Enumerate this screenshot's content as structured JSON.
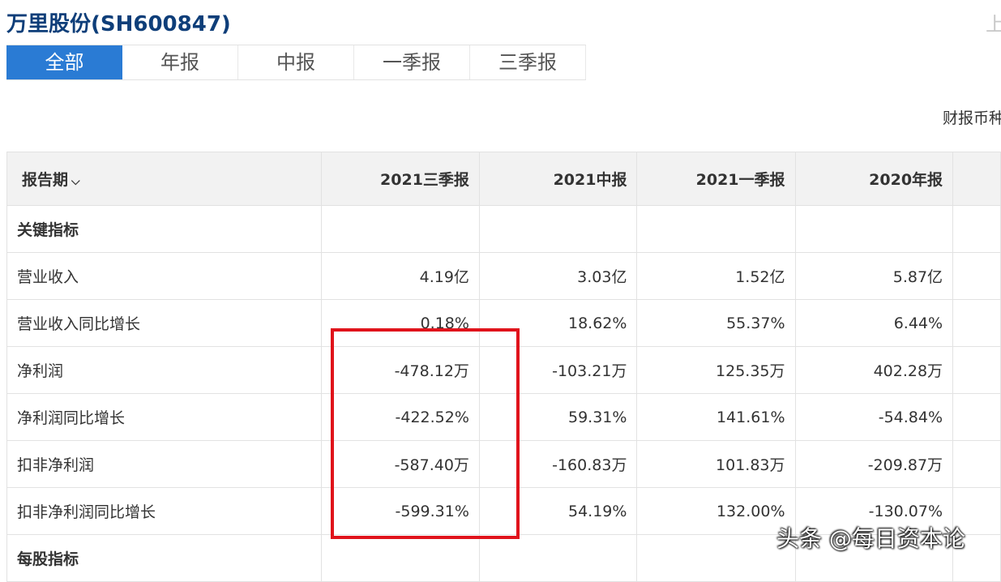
{
  "header": {
    "title": "万里股份(SH600847)",
    "right_cut_text": "上"
  },
  "tabs": [
    {
      "label": "全部",
      "active": true
    },
    {
      "label": "年报",
      "active": false
    },
    {
      "label": "中报",
      "active": false
    },
    {
      "label": "一季报",
      "active": false
    },
    {
      "label": "三季报",
      "active": false
    }
  ],
  "currency_note": "财报币种",
  "table": {
    "header": {
      "first": "报告期",
      "columns": [
        "2021三季报",
        "2021中报",
        "2021一季报",
        "2020年报"
      ]
    },
    "rows": [
      {
        "label": "关键指标",
        "section": true,
        "values": [
          "",
          "",
          "",
          ""
        ]
      },
      {
        "label": "营业收入",
        "values": [
          "4.19亿",
          "3.03亿",
          "1.52亿",
          "5.87亿"
        ]
      },
      {
        "label": "营业收入同比增长",
        "values": [
          "0.18%",
          "18.62%",
          "55.37%",
          "6.44%"
        ]
      },
      {
        "label": "净利润",
        "values": [
          "-478.12万",
          "-103.21万",
          "125.35万",
          "402.28万"
        ]
      },
      {
        "label": "净利润同比增长",
        "values": [
          "-422.52%",
          "59.31%",
          "141.61%",
          "-54.84%"
        ]
      },
      {
        "label": "扣非净利润",
        "values": [
          "-587.40万",
          "-160.83万",
          "101.83万",
          "-209.87万"
        ]
      },
      {
        "label": "扣非净利润同比增长",
        "values": [
          "-599.31%",
          "54.19%",
          "132.00%",
          "-130.07%"
        ]
      },
      {
        "label": "每股指标",
        "section": true,
        "values": [
          "",
          "",
          "",
          ""
        ]
      }
    ]
  },
  "watermark": "头条 @每日资本论",
  "colors": {
    "title": "#0e3e79",
    "tab_active_bg": "#2a7bd4",
    "header_bg": "#f2f2f2",
    "highlight_box": "#e0131b"
  }
}
